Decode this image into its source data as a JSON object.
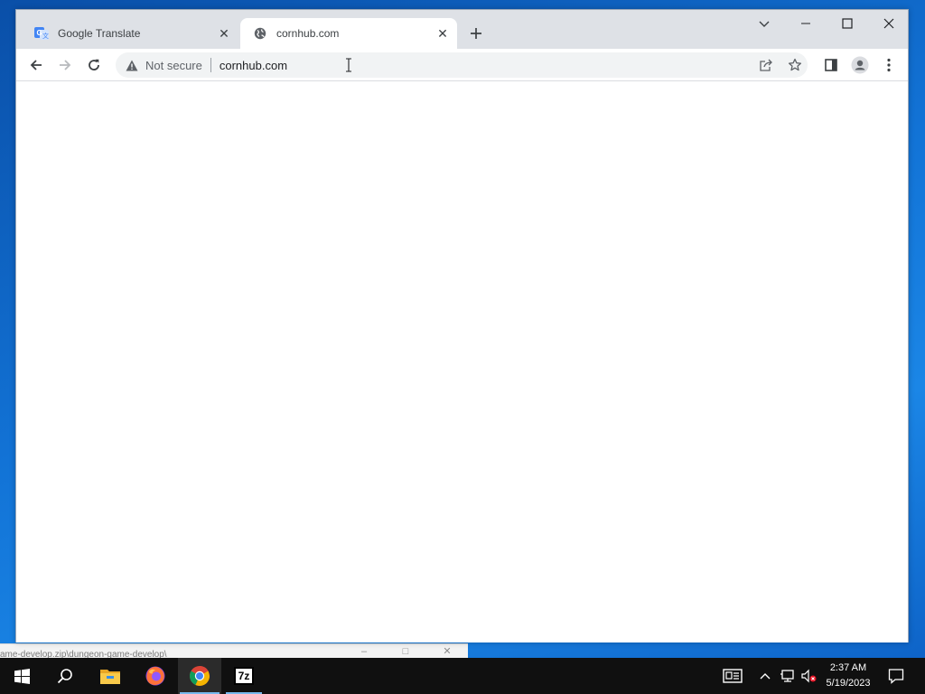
{
  "background_window": {
    "path_text": "ame-develop.zip\\dungeon-game-develop\\"
  },
  "browser": {
    "tabs": [
      {
        "title": "Google Translate",
        "icon": "google-translate-icon",
        "active": false
      },
      {
        "title": "cornhub.com",
        "icon": "globe-icon",
        "active": true
      }
    ],
    "new_tab_icon": "plus-icon",
    "window_controls": [
      "tab-search-icon",
      "minimize-icon",
      "maximize-icon",
      "close-icon"
    ],
    "toolbar": {
      "back_icon": "arrow-left-icon",
      "forward_icon": "arrow-right-icon",
      "reload_icon": "reload-icon"
    },
    "omnibox": {
      "security_label": "Not secure",
      "url": "cornhub.com",
      "right_icons": [
        "share-icon",
        "star-icon"
      ]
    },
    "extra_icons": [
      "side-panel-icon",
      "profile-icon",
      "menu-icon"
    ]
  },
  "taskbar": {
    "apps": [
      "windows-start-icon",
      "search-icon",
      "file-explorer-icon",
      "firefox-icon",
      "chrome-icon",
      "7zip-icon"
    ],
    "active_app": "chrome-icon",
    "app_7zip_label": "7z",
    "clock": {
      "time": "2:37 AM",
      "date": "5/19/2023"
    }
  },
  "colors": {
    "tabstrip": "#dee1e6",
    "omnibox": "#f1f3f4",
    "taskbar": "#101010",
    "taskbar_indicator": "#76b9ed"
  }
}
